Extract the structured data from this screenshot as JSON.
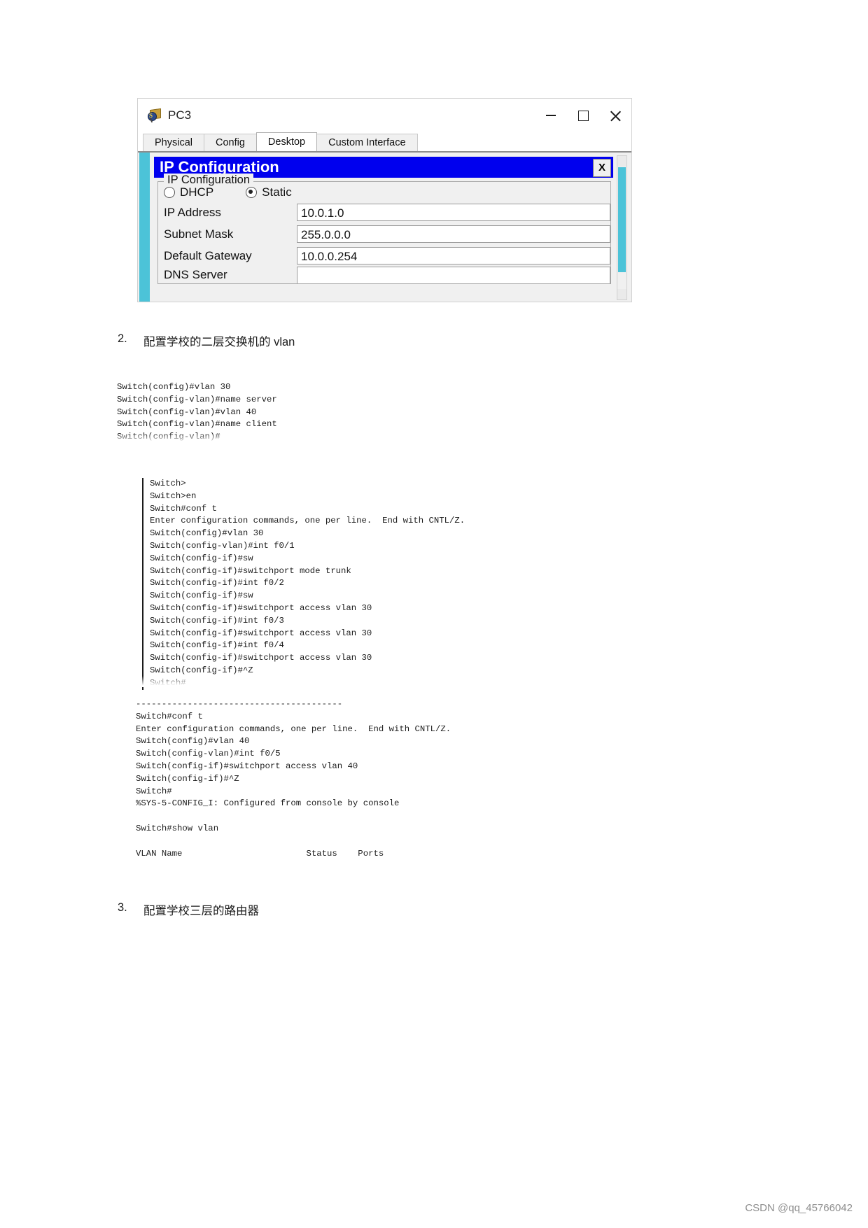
{
  "window": {
    "title": "PC3",
    "app_icon": "packet-tracer-pc-icon",
    "minimize_label": "",
    "maximize_label": "",
    "close_label": "",
    "tabs": [
      {
        "label": "Physical",
        "active": false
      },
      {
        "label": "Config",
        "active": false
      },
      {
        "label": "Desktop",
        "active": true
      },
      {
        "label": "Custom Interface",
        "active": false
      }
    ]
  },
  "ip_configuration": {
    "title": "IP Configuration",
    "close_button": "X",
    "group_legend": "IP Configuration",
    "dhcp_label": "DHCP",
    "static_label": "Static",
    "mode_selected": "Static",
    "fields": [
      {
        "label": "IP Address",
        "value": "10.0.1.0"
      },
      {
        "label": "Subnet Mask",
        "value": "255.0.0.0"
      },
      {
        "label": "Default Gateway",
        "value": "10.0.0.254"
      },
      {
        "label": "DNS Server",
        "value": ""
      }
    ]
  },
  "document": {
    "heading_2_number": "2.",
    "heading_2_text": "配置学校的二层交换机的 vlan",
    "heading_3_number": "3.",
    "heading_3_text": "配置学校三层的路由器",
    "terminal_block_1": "Switch(config)#vlan 30\nSwitch(config-vlan)#name server\nSwitch(config-vlan)#vlan 40\nSwitch(config-vlan)#name client\nSwitch(config-vlan)#",
    "terminal_block_2": "Switch>\nSwitch>en\nSwitch#conf t\nEnter configuration commands, one per line.  End with CNTL/Z.\nSwitch(config)#vlan 30\nSwitch(config-vlan)#int f0/1\nSwitch(config-if)#sw\nSwitch(config-if)#switchport mode trunk\nSwitch(config-if)#int f0/2\nSwitch(config-if)#sw\nSwitch(config-if)#switchport access vlan 30\nSwitch(config-if)#int f0/3\nSwitch(config-if)#switchport access vlan 30\nSwitch(config-if)#int f0/4\nSwitch(config-if)#switchport access vlan 30\nSwitch(config-if)#^Z\nSwitch#",
    "terminal_block_3": "----------------------------------------\nSwitch#conf t\nEnter configuration commands, one per line.  End with CNTL/Z.\nSwitch(config)#vlan 40\nSwitch(config-vlan)#int f0/5\nSwitch(config-if)#switchport access vlan 40\nSwitch(config-if)#^Z\nSwitch#\n%SYS-5-CONFIG_I: Configured from console by console\n\nSwitch#show vlan\n\nVLAN Name                        Status    Ports"
  },
  "watermark": "CSDN @qq_45766042"
}
